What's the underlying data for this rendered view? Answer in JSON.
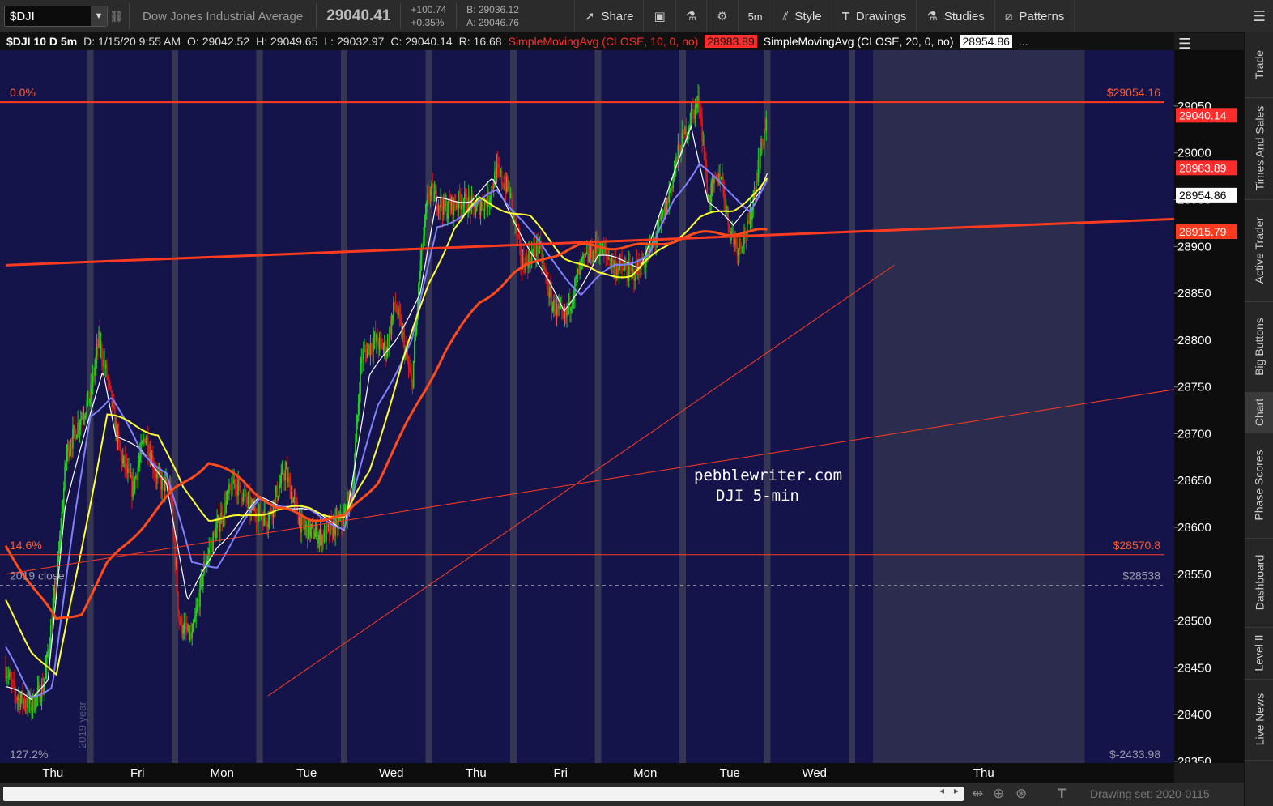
{
  "toolbar": {
    "symbol": "$DJI",
    "instrument_name": "Dow Jones Industrial Average",
    "last_price": "29040.41",
    "net_change": "+100.74",
    "pct_change": "+0.35%",
    "bid": "B: 29036.12",
    "ask": "A: 29046.76",
    "share_label": "Share",
    "timeframe_label": "5m",
    "style_label": "Style",
    "drawings_label": "Drawings",
    "studies_label": "Studies",
    "patterns_label": "Patterns"
  },
  "info_bar": {
    "title": "$DJI 10 D 5m",
    "date": "D: 1/15/20 9:55 AM",
    "open": "O: 29042.52",
    "high": "H: 29049.65",
    "low": "L: 29032.97",
    "close": "C: 29040.14",
    "range": "R: 16.68",
    "sma10_label": "SimpleMovingAvg (CLOSE, 10, 0, no)",
    "sma10_value": "28983.89",
    "sma20_label": "SimpleMovingAvg (CLOSE, 20, 0, no)",
    "sma20_value": "28954.86",
    "more": "..."
  },
  "side_tabs": [
    "Trade",
    "Times And Sales",
    "Active Trader",
    "Big Buttons",
    "Chart",
    "Phase Scores",
    "Dashboard",
    "Level II",
    "Live News"
  ],
  "side_active": "Chart",
  "bottom_bar": {
    "drawing_set": "Drawing set: 2020-0115"
  },
  "chart_data": {
    "type": "candlestick",
    "y_axis": {
      "range": [
        28350,
        29075
      ],
      "ticks": [
        28350,
        28400,
        28450,
        28500,
        28550,
        28600,
        28650,
        28700,
        28750,
        28800,
        28850,
        28900,
        28950,
        29000,
        29050
      ],
      "tick_labels": [
        "28350",
        "28400",
        "28450",
        "28500",
        "28550",
        "28600",
        "28650",
        "28700",
        "28750",
        "28800",
        "28850",
        "28900",
        "28950",
        "29000",
        "29050"
      ]
    },
    "x_axis": {
      "tick_labels": [
        "Thu",
        "Fri",
        "Mon",
        "Tue",
        "Wed",
        "Thu",
        "Fri",
        "Mon",
        "Tue",
        "Wed",
        "Thu"
      ],
      "session_index": [
        0.5,
        1.5,
        2.5,
        3.5,
        4.5,
        5.5,
        6.5,
        7.5,
        8.5,
        9.5,
        11.5
      ],
      "future_sessions": 2,
      "sessions_shown": 12
    },
    "price_path": [
      [
        0,
        28450
      ],
      [
        0.12,
        28420
      ],
      [
        0.3,
        28410
      ],
      [
        0.45,
        28430
      ],
      [
        0.6,
        28540
      ],
      [
        0.72,
        28680
      ],
      [
        0.9,
        28720
      ],
      [
        1.0,
        28740
      ],
      [
        1.1,
        28800
      ],
      [
        1.2,
        28760
      ],
      [
        1.35,
        28680
      ],
      [
        1.5,
        28640
      ],
      [
        1.65,
        28700
      ],
      [
        1.8,
        28650
      ],
      [
        1.95,
        28640
      ],
      [
        2.05,
        28500
      ],
      [
        2.2,
        28480
      ],
      [
        2.35,
        28560
      ],
      [
        2.5,
        28600
      ],
      [
        2.7,
        28650
      ],
      [
        2.9,
        28620
      ],
      [
        3.1,
        28610
      ],
      [
        3.3,
        28660
      ],
      [
        3.5,
        28600
      ],
      [
        3.75,
        28590
      ],
      [
        4.0,
        28610
      ],
      [
        4.1,
        28640
      ],
      [
        4.2,
        28780
      ],
      [
        4.35,
        28800
      ],
      [
        4.5,
        28790
      ],
      [
        4.6,
        28840
      ],
      [
        4.7,
        28800
      ],
      [
        4.8,
        28750
      ],
      [
        4.9,
        28880
      ],
      [
        5.0,
        28960
      ],
      [
        5.2,
        28940
      ],
      [
        5.4,
        28950
      ],
      [
        5.55,
        28940
      ],
      [
        5.7,
        28950
      ],
      [
        5.8,
        28980
      ],
      [
        5.95,
        28960
      ],
      [
        6.1,
        28880
      ],
      [
        6.3,
        28900
      ],
      [
        6.45,
        28840
      ],
      [
        6.6,
        28820
      ],
      [
        6.8,
        28880
      ],
      [
        7.0,
        28900
      ],
      [
        7.2,
        28880
      ],
      [
        7.4,
        28870
      ],
      [
        7.6,
        28890
      ],
      [
        7.8,
        28940
      ],
      [
        7.95,
        29000
      ],
      [
        8.1,
        29040
      ],
      [
        8.2,
        29055
      ],
      [
        8.3,
        28950
      ],
      [
        8.45,
        28980
      ],
      [
        8.55,
        28920
      ],
      [
        8.65,
        28900
      ],
      [
        8.78,
        28920
      ],
      [
        8.9,
        28990
      ],
      [
        9.0,
        29040
      ]
    ],
    "moving_averages": [
      {
        "color": "#ffffff",
        "values": [
          [
            0,
            28430
          ],
          [
            0.3,
            28415
          ],
          [
            0.5,
            28440
          ],
          [
            0.7,
            28620
          ],
          [
            1.0,
            28720
          ],
          [
            1.15,
            28770
          ],
          [
            1.3,
            28700
          ],
          [
            1.6,
            28680
          ],
          [
            1.9,
            28650
          ],
          [
            2.15,
            28520
          ],
          [
            2.5,
            28580
          ],
          [
            3.0,
            28630
          ],
          [
            3.5,
            28620
          ],
          [
            4.0,
            28600
          ],
          [
            4.3,
            28760
          ],
          [
            4.6,
            28800
          ],
          [
            4.9,
            28850
          ],
          [
            5.1,
            28950
          ],
          [
            5.5,
            28950
          ],
          [
            5.75,
            28970
          ],
          [
            6.0,
            28930
          ],
          [
            6.3,
            28880
          ],
          [
            6.6,
            28830
          ],
          [
            7.0,
            28890
          ],
          [
            7.5,
            28880
          ],
          [
            7.8,
            28950
          ],
          [
            8.1,
            29030
          ],
          [
            8.3,
            28950
          ],
          [
            8.6,
            28920
          ],
          [
            8.9,
            28960
          ],
          [
            9.0,
            28980
          ]
        ]
      },
      {
        "color": "#8080ff",
        "values": [
          [
            0,
            28470
          ],
          [
            0.3,
            28420
          ],
          [
            0.55,
            28430
          ],
          [
            0.8,
            28600
          ],
          [
            1.0,
            28720
          ],
          [
            1.25,
            28740
          ],
          [
            1.6,
            28680
          ],
          [
            1.9,
            28660
          ],
          [
            2.2,
            28560
          ],
          [
            2.5,
            28560
          ],
          [
            3.0,
            28630
          ],
          [
            3.5,
            28620
          ],
          [
            4.0,
            28600
          ],
          [
            4.4,
            28730
          ],
          [
            4.8,
            28800
          ],
          [
            5.1,
            28920
          ],
          [
            5.5,
            28940
          ],
          [
            5.8,
            28960
          ],
          [
            6.1,
            28930
          ],
          [
            6.4,
            28890
          ],
          [
            6.8,
            28850
          ],
          [
            7.2,
            28880
          ],
          [
            7.6,
            28890
          ],
          [
            7.9,
            28950
          ],
          [
            8.2,
            28990
          ],
          [
            8.5,
            28960
          ],
          [
            8.8,
            28940
          ],
          [
            9.0,
            28970
          ]
        ]
      },
      {
        "color": "#ffff30",
        "values": [
          [
            0,
            28520
          ],
          [
            0.3,
            28470
          ],
          [
            0.6,
            28440
          ],
          [
            0.9,
            28580
          ],
          [
            1.2,
            28720
          ],
          [
            1.5,
            28710
          ],
          [
            1.8,
            28700
          ],
          [
            2.1,
            28640
          ],
          [
            2.4,
            28610
          ],
          [
            2.8,
            28610
          ],
          [
            3.2,
            28620
          ],
          [
            3.6,
            28620
          ],
          [
            4.0,
            28610
          ],
          [
            4.3,
            28660
          ],
          [
            4.7,
            28780
          ],
          [
            5.0,
            28860
          ],
          [
            5.3,
            28920
          ],
          [
            5.6,
            28950
          ],
          [
            5.9,
            28940
          ],
          [
            6.2,
            28930
          ],
          [
            6.6,
            28890
          ],
          [
            7.0,
            28870
          ],
          [
            7.4,
            28870
          ],
          [
            7.8,
            28900
          ],
          [
            8.2,
            28930
          ],
          [
            8.6,
            28940
          ],
          [
            8.9,
            28960
          ],
          [
            9.0,
            28970
          ]
        ]
      },
      {
        "color": "#ff4a1a",
        "values": [
          [
            0,
            28580
          ],
          [
            0.3,
            28540
          ],
          [
            0.6,
            28500
          ],
          [
            0.9,
            28510
          ],
          [
            1.2,
            28560
          ],
          [
            1.6,
            28600
          ],
          [
            2.0,
            28640
          ],
          [
            2.4,
            28670
          ],
          [
            2.8,
            28650
          ],
          [
            3.2,
            28620
          ],
          [
            3.6,
            28610
          ],
          [
            4.0,
            28610
          ],
          [
            4.4,
            28650
          ],
          [
            4.8,
            28720
          ],
          [
            5.2,
            28790
          ],
          [
            5.6,
            28840
          ],
          [
            6.0,
            28870
          ],
          [
            6.4,
            28890
          ],
          [
            6.8,
            28900
          ],
          [
            7.2,
            28900
          ],
          [
            7.6,
            28900
          ],
          [
            8.0,
            28910
          ],
          [
            8.4,
            28915
          ],
          [
            8.8,
            28915
          ],
          [
            9.0,
            28916
          ]
        ]
      }
    ],
    "horizontal_lines": [
      {
        "value": 29054.16,
        "label_left": "0.0%",
        "label_right": "$29054.16",
        "color": "#ff3b1f"
      },
      {
        "value": 28570.8,
        "label_left": "14.6%",
        "label_right": "$28570.8",
        "color": "#ff3b1f"
      },
      {
        "value": 28538,
        "label_left": "2019 close",
        "label_right": "$28538",
        "color": "#aaaaaa",
        "dashed": true
      }
    ],
    "trend_lines": [
      {
        "from": [
          0,
          28880
        ],
        "to": [
          14,
          28930
        ],
        "color": "#ff3b1f",
        "width": 3
      },
      {
        "from": [
          3.1,
          28420
        ],
        "to": [
          10.5,
          28880
        ],
        "color": "#ff3b1f",
        "width": 1
      },
      {
        "from": [
          0,
          28550
        ],
        "to": [
          14,
          28750
        ],
        "color": "#ff3b1f",
        "width": 1
      }
    ],
    "price_badges": [
      {
        "value": "29040.14",
        "price": 29040.14,
        "bg": "#ff2c2c",
        "fg": "#ffffff"
      },
      {
        "value": "28983.89",
        "price": 28983.89,
        "bg": "#ff2c2c",
        "fg": "#ffffff"
      },
      {
        "value": "28954.86",
        "price": 28954.86,
        "bg": "#ffffff",
        "fg": "#000000"
      },
      {
        "value": "28915.79",
        "price": 28915.79,
        "bg": "#ff3b1f",
        "fg": "#ffffff"
      }
    ],
    "annotations": [
      "pebblewriter.com",
      "DJI 5-min"
    ],
    "bottom_left_label": "127.2%",
    "bottom_right_label": "$-2433.98",
    "vertical_label": "2019 year",
    "colors": {
      "background": "#14144a",
      "session_separator": "#3a3a55",
      "future_background": "#2c2c4e",
      "up_candle": "#22d022",
      "down_candle": "#e01818"
    }
  }
}
